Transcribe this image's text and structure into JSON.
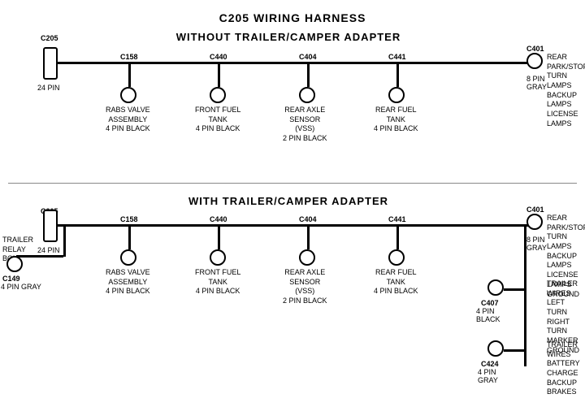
{
  "title": "C205 WIRING HARNESS",
  "section1": {
    "label": "WITHOUT  TRAILER/CAMPER ADAPTER",
    "left_connector": {
      "id": "C205",
      "pin_label": "24 PIN"
    },
    "right_connector": {
      "id": "C401",
      "pin_label": "8 PIN\nGRAY",
      "description": "REAR PARK/STOP\nTURN LAMPS\nBACKUP LAMPS\nLICENSE LAMPS"
    },
    "connectors": [
      {
        "id": "C158",
        "label": "RABS VALVE\nASSEMBLY\n4 PIN BLACK"
      },
      {
        "id": "C440",
        "label": "FRONT FUEL\nTANK\n4 PIN BLACK"
      },
      {
        "id": "C404",
        "label": "REAR AXLE\nSENSOR\n(VSS)\n2 PIN BLACK"
      },
      {
        "id": "C441",
        "label": "REAR FUEL\nTANK\n4 PIN BLACK"
      }
    ]
  },
  "section2": {
    "label": "WITH  TRAILER/CAMPER ADAPTER",
    "left_connector": {
      "id": "C205",
      "pin_label": "24 PIN"
    },
    "right_connector": {
      "id": "C401",
      "pin_label": "8 PIN\nGRAY",
      "description": "REAR PARK/STOP\nTURN LAMPS\nBACKUP LAMPS\nLICENSE LAMPS\nGROUND"
    },
    "trailer_relay": {
      "label": "TRAILER\nRELAY\nBOX"
    },
    "c149": {
      "id": "C149",
      "label": "4 PIN GRAY"
    },
    "connectors": [
      {
        "id": "C158",
        "label": "RABS VALVE\nASSEMBLY\n4 PIN BLACK"
      },
      {
        "id": "C440",
        "label": "FRONT FUEL\nTANK\n4 PIN BLACK"
      },
      {
        "id": "C404",
        "label": "REAR AXLE\nSENSOR\n(VSS)\n2 PIN BLACK"
      },
      {
        "id": "C441",
        "label": "REAR FUEL\nTANK\n4 PIN BLACK"
      }
    ],
    "right_extras": [
      {
        "id": "C407",
        "pin_label": "4 PIN\nBLACK",
        "description": "TRAILER WIRES\nLEFT TURN\nRIGHT TURN\nMARKER\nGROUND"
      },
      {
        "id": "C424",
        "pin_label": "4 PIN\nGRAY",
        "description": "TRAILER WIRES\nBATTERY CHARGE\nBACKUP\nBRAKES"
      }
    ]
  }
}
